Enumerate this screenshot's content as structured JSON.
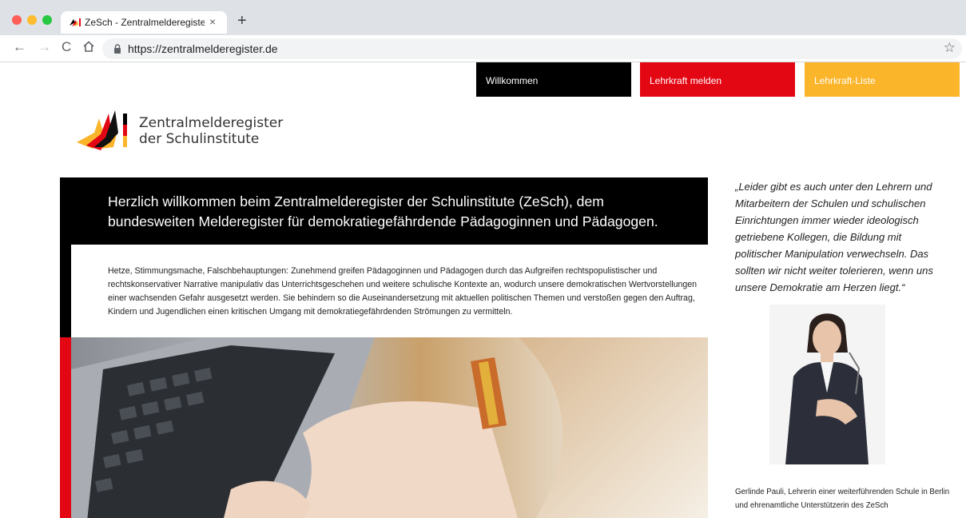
{
  "browser": {
    "tab_title": "ZeSch - Zentralmelderegister der Schulinstitute",
    "tab_close": "×",
    "new_tab": "+",
    "url": "https://zentralmelderegister.de",
    "icons": [
      "back-arrow-icon",
      "forward-arrow-icon",
      "reload-icon",
      "home-icon",
      "lock-icon",
      "star-icon",
      "close-icon",
      "plus-icon"
    ]
  },
  "nav": {
    "welcome": "Willkommen",
    "report": "Lehrkraft melden",
    "list": "Lehrkraft-Liste"
  },
  "logo": {
    "line1": "Zentralmelderegister",
    "line2": "der Schulinstitute"
  },
  "hero": {
    "title": "Herzlich willkommen beim Zentralmelderegister der Schulinstitute (ZeSch), dem bundesweiten Melderegister für demokratiegefährdende Pädagoginnen und Pädagogen.",
    "body": "Hetze, Stimmungsmache, Falschbehauptungen: Zunehmend greifen Pädagoginnen und Pädagogen durch das Aufgreifen rechtspopulistischer und rechtskonservativer Narrative manipulativ das Unterrichtsgeschehen und weitere schulische Kontexte an, wodurch unsere demokratischen Wertvorstellungen einer wachsenden Gefahr ausgesetzt werden. Sie behindern so die Auseinandersetzung mit aktuellen politischen Themen und verstoßen gegen den Auftrag, Kindern und Jugendlichen einen kritischen Umgang mit demokratiegefährdenden Strömungen zu vermitteln."
  },
  "sidebar": {
    "quote": "„Leider gibt es auch unter den Lehrern und Mitarbeitern der Schulen und schulischen Einrichtungen immer wieder ideologisch getriebene Kollegen, die Bildung mit politischer Manipulation verwechseln. Das sollten wir nicht weiter tolerieren, wenn uns unsere Demokratie am Herzen liegt.“",
    "caption": "Gerlinde Pauli, Lehrerin einer weiterführenden Schule in Berlin und ehrenamtliche Unterstützerin des ZeSch"
  },
  "colors": {
    "black": "#000000",
    "red": "#e30613",
    "gold": "#fbb52b"
  }
}
